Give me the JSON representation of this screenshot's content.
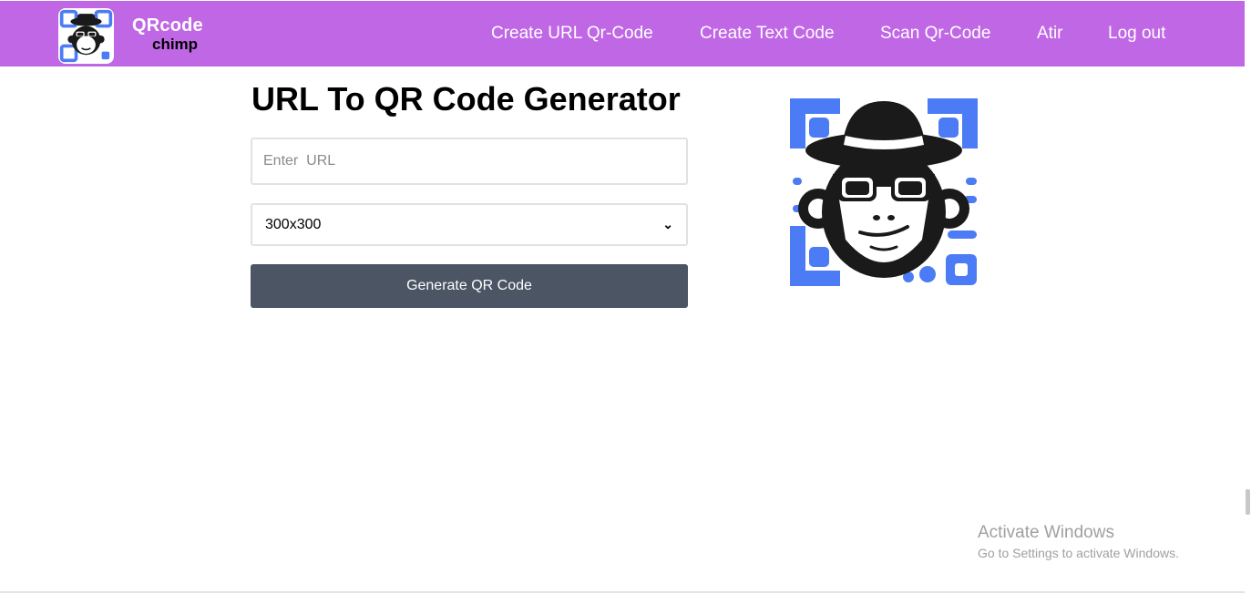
{
  "brand": {
    "name_top": "QRcode",
    "name_bottom": "chimp"
  },
  "nav": {
    "items": [
      {
        "label": "Create URL Qr-Code"
      },
      {
        "label": "Create Text Code"
      },
      {
        "label": "Scan Qr-Code"
      },
      {
        "label": "Atir"
      },
      {
        "label": "Log out"
      }
    ]
  },
  "main": {
    "title": "URL To QR Code Generator",
    "url_placeholder": "Enter  URL",
    "url_value": "",
    "size_selected": "300x300",
    "generate_label": "Generate QR Code"
  },
  "watermark": {
    "title": "Activate Windows",
    "subtitle": "Go to Settings to activate Windows."
  },
  "colors": {
    "navbar": "#c067e6",
    "button": "#4b5563",
    "qr_blue": "#4b7bf5"
  },
  "icons": {
    "logo": "chimp-qr-logo-icon",
    "select_arrow": "chevron-down-icon",
    "hero": "chimp-qr-illustration"
  }
}
